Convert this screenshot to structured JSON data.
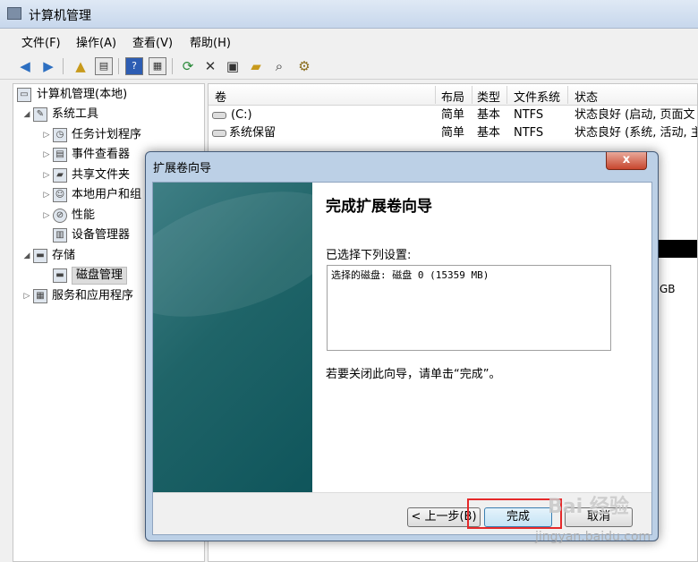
{
  "window": {
    "title": "计算机管理"
  },
  "menu": [
    "文件(F)",
    "操作(A)",
    "查看(V)",
    "帮助(H)"
  ],
  "tree": {
    "root": "计算机管理(本地)",
    "system_tools": "系统工具",
    "task_scheduler": "任务计划程序",
    "event_viewer": "事件查看器",
    "shared_folders": "共享文件夹",
    "local_users": "本地用户和组",
    "performance": "性能",
    "device_manager": "设备管理器",
    "storage": "存储",
    "disk_management": "磁盘管理",
    "services_apps": "服务和应用程序"
  },
  "list": {
    "columns": [
      "卷",
      "布局",
      "类型",
      "文件系统",
      "状态"
    ],
    "rows": [
      {
        "volume": "(C:)",
        "layout": "简单",
        "type": "基本",
        "fs": "NTFS",
        "status": "状态良好 (启动, 页面文"
      },
      {
        "volume": "系统保留",
        "layout": "简单",
        "type": "基本",
        "fs": "NTFS",
        "status": "状态良好 (系统, 活动, 主"
      }
    ],
    "partial_gb": "GB"
  },
  "dialog": {
    "title": "扩展卷向导",
    "close": "x",
    "heading": "完成扩展卷向导",
    "selected_label": "已选择下列设置:",
    "settings_text": "选择的磁盘: 磁盘 0 (15359 MB)",
    "hint": "若要关闭此向导，请单击“完成”。",
    "back_button": "< 上一步(B)",
    "finish_button": "完成",
    "cancel_button": "取消"
  },
  "watermark": {
    "brand": "Bai  经验",
    "url": "jingyan.baidu.com"
  }
}
